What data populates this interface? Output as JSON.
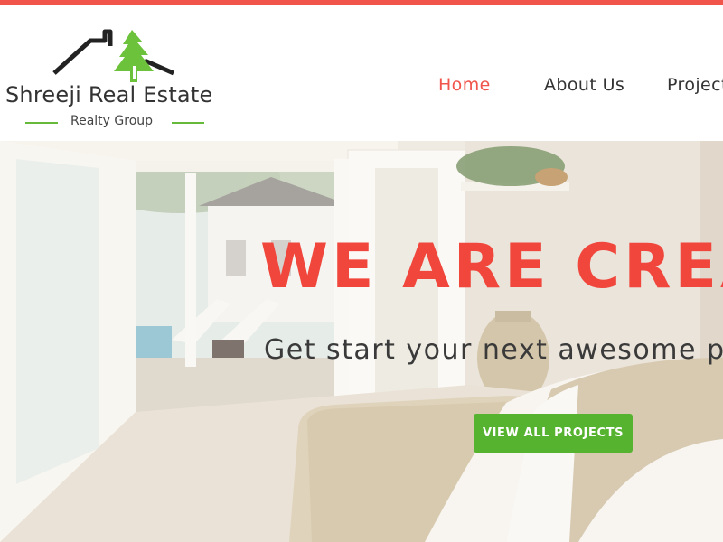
{
  "brand": {
    "name": "Shreeji Real Estate",
    "tagline": "Realty Group",
    "logo_icon": "house-tree-logo",
    "colors": {
      "roof": "#222222",
      "tree": "#6cc23a"
    }
  },
  "nav": {
    "items": [
      {
        "label": "Home",
        "active": true
      },
      {
        "label": "About Us",
        "active": false
      },
      {
        "label": "Projects",
        "active": false
      }
    ]
  },
  "hero": {
    "title": "WE ARE CREATIVE",
    "subtitle": "Get start your next awesome project",
    "cta_label": "VIEW ALL PROJECTS"
  },
  "colors": {
    "accent": "#f0544a",
    "cta": "#55b330",
    "top_bar": "#f0544a"
  }
}
